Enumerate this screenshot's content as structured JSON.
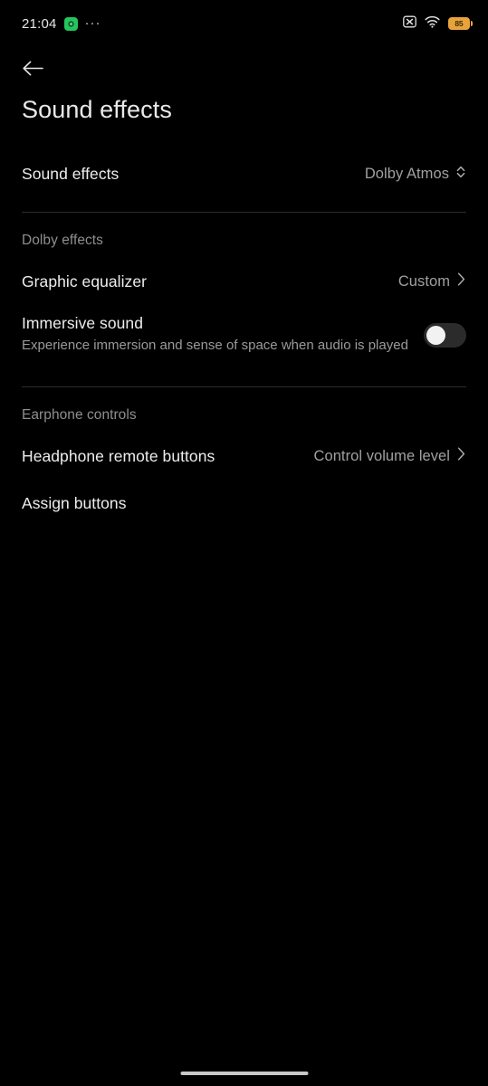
{
  "status_bar": {
    "time": "21:04",
    "notification_icon": "app-notification-icon",
    "overflow_dots": "···",
    "mute_icon": "mute-crossed-icon",
    "wifi_icon": "wifi-icon",
    "battery_level": "85",
    "battery_color": "#e8a33d"
  },
  "nav": {
    "back_icon": "back-arrow-icon"
  },
  "header": {
    "title": "Sound effects"
  },
  "rows": [
    {
      "name": "sound-effects",
      "title": "Sound effects",
      "value": "Dolby Atmos",
      "indicator": "updown-chevron-icon"
    },
    {
      "name": "graphic-equalizer",
      "title": "Graphic equalizer",
      "value": "Custom",
      "indicator": "chevron-right-icon"
    },
    {
      "name": "immersive-sound",
      "title": "Immersive sound",
      "subtitle": "Experience immersion and sense of space when audio is played",
      "toggle_state": "off"
    },
    {
      "name": "headphone-remote-buttons",
      "title": "Headphone remote buttons",
      "value": "Control volume level",
      "indicator": "chevron-right-icon"
    },
    {
      "name": "assign-buttons",
      "title": "Assign buttons"
    }
  ],
  "sections": {
    "dolby_effects": "Dolby effects",
    "earphone_controls": "Earphone controls"
  },
  "system": {
    "home_indicator": "home-gesture-bar"
  }
}
